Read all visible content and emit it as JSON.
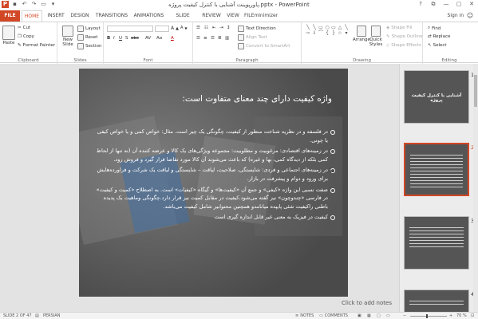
{
  "window": {
    "title": "پاورپوینت آشنایی با کنترل کیفیت پروژه.pptx - PowerPoint",
    "app_logo": "P",
    "controls": [
      "?",
      "⧉",
      "—",
      "▢",
      "✕"
    ]
  },
  "tabs": {
    "file": "FILE",
    "items": [
      "HOME",
      "INSERT",
      "DESIGN",
      "TRANSITIONS",
      "ANIMATIONS",
      "SLIDE SHOW",
      "REVIEW",
      "VIEW",
      "FILEminimizer"
    ],
    "active": "HOME",
    "sign_in": "Sign in"
  },
  "ribbon": {
    "clipboard": {
      "paste": "Paste",
      "cut": "Cut",
      "copy": "Copy",
      "format_painter": "Format Painter",
      "label": "Clipboard"
    },
    "slides": {
      "new_slide": "New Slide",
      "layout": "Layout",
      "reset": "Reset",
      "section": "Section",
      "label": "Slides"
    },
    "font": {
      "label": "Font"
    },
    "paragraph": {
      "text_direction": "Text Direction",
      "align_text": "Align Text",
      "convert_smartart": "Convert to SmartArt",
      "label": "Paragraph"
    },
    "drawing": {
      "arrange": "Arrange",
      "quick_styles": "Quick Styles",
      "shape_fill": "Shape Fill",
      "shape_outline": "Shape Outline",
      "shape_effects": "Shape Effects",
      "label": "Drawing"
    },
    "editing": {
      "find": "Find",
      "replace": "Replace",
      "select": "Select",
      "label": "Editing"
    }
  },
  "slide": {
    "title": "واژه کیفیت دارای چند معنای متفاوت است:",
    "bullets": [
      "در فلسفه و در نظریه شناخت منظور از کیفیت، چگونگی یک چیز است. مثال: خواص کمی و یا خواص کیفی یا چونی.",
      "در زمینه‌های اقتصادی: مرغوبیت و مطلوبیت: مجموعه ویژگی‌های یک کالا و عرضه کننده آن (نه تنها از لحاظ کمی بلکه از دیدگاه کمی، بها و غیره) که باعث می‌شوند آن کالا مورد تقاضا قرار گیرد و فروش رود.",
      "در زمینه‌های اجتماعی و فردی: شایستگی، صلاحیت، لیاقت – شایستگی و لیاقت یک شرکت و فراورده‌هایش برای ورود و دوام و پیشرفت در بازار.",
      "صفت نسبی این واژه «کیفی» و جمع آن «کیفیت‌ها» و گیگاه «کیفیات» است. به اصطلاح «کمیت و کیفیت» در فارسی «چندوچون» نیز گفته می‌شود.کیفیت در مقابل کمیت نیز قرار دارد.چگونگی وماهیت یک پدیده باطنی راکیفیت شئی پایپده میانامدو همچنین محتوابیز شامل کیفیت می‌باشد.",
      "کیفیت در فیزیک به معنی غیر قابل اندازه گیری است"
    ]
  },
  "notes_hint": "Click to add notes",
  "thumbnails": [
    {
      "number": "1",
      "title": "آشنایی با کنترل کیفیت پروژه",
      "selected": false
    },
    {
      "number": "2",
      "title": "",
      "selected": true
    },
    {
      "number": "3",
      "title": "",
      "selected": false
    },
    {
      "number": "4",
      "title": "",
      "selected": false
    }
  ],
  "status": {
    "slide_of": "SLIDE 2 OF 47",
    "language": "PERSIAN",
    "notes": "NOTES",
    "comments": "COMMENTS",
    "zoom": "70 %"
  },
  "colors": {
    "accent": "#d24726",
    "slide_bg": "#5c5c5c",
    "workspace": "#e3e3e3"
  }
}
